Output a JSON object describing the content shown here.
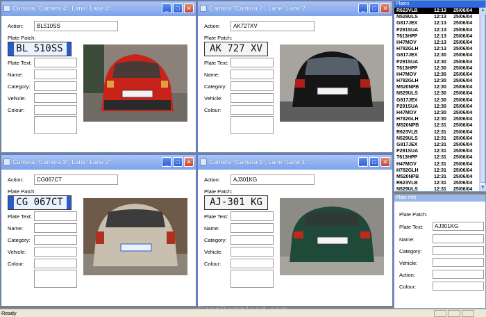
{
  "cameras": [
    {
      "title": "Camera \"Camera 4\", Lane \"Lane 4\"",
      "action": "BL510SS",
      "plate": "BL 510SS",
      "car": "red"
    },
    {
      "title": "Camera \"Camera 2\", Lane \"Lane 2\"",
      "action": "AK727XV",
      "plate": "AK 727 XV",
      "car": "black"
    },
    {
      "title": "Camera \"Camera 3\", Lane \"Lane 3\"",
      "action": "CG067CT",
      "plate": "CG 067CT",
      "car": "silver"
    },
    {
      "title": "Camera \"Camera 1\", Lane \"Lane 1\"",
      "action": "AJ301KG",
      "plate": "AJ-301 KG",
      "car": "green"
    }
  ],
  "labels": {
    "action": "Action:",
    "plate_patch": "Plate Patch:",
    "plate_text": "Plate Text:",
    "name": "Name:",
    "category": "Category:",
    "vehicle": "Vehicle:",
    "colour": "Colour:"
  },
  "plates_panel": {
    "title": "Plates",
    "rows": [
      [
        "R623VLB",
        "12:13",
        "25/06/04"
      ],
      [
        "N529ULS",
        "12:13",
        "25/06/04"
      ],
      [
        "G817JEX",
        "12:13",
        "25/06/04"
      ],
      [
        "P291SUA",
        "12:13",
        "25/06/04"
      ],
      [
        "T613HPP",
        "12:13",
        "25/06/04"
      ],
      [
        "H47MOV",
        "12:13",
        "25/06/04"
      ],
      [
        "H782GLH",
        "12:13",
        "25/06/04"
      ],
      [
        "G817JEX",
        "12:30",
        "25/06/04"
      ],
      [
        "P291SUA",
        "12:30",
        "25/06/04"
      ],
      [
        "T613HPP",
        "12:30",
        "25/06/04"
      ],
      [
        "H47MOV",
        "12:30",
        "25/06/04"
      ],
      [
        "H782GLH",
        "12:30",
        "25/06/04"
      ],
      [
        "M520NPB",
        "12:30",
        "25/06/04"
      ],
      [
        "N529ULS",
        "12:30",
        "25/06/04"
      ],
      [
        "G817JEX",
        "12:30",
        "25/06/04"
      ],
      [
        "P291SUA",
        "12:30",
        "25/06/04"
      ],
      [
        "H47MOV",
        "12:30",
        "25/06/04"
      ],
      [
        "H782GLH",
        "12:30",
        "25/06/04"
      ],
      [
        "M520NPB",
        "12:31",
        "25/06/04"
      ],
      [
        "R623VLB",
        "12:31",
        "25/06/04"
      ],
      [
        "N529ULS",
        "12:31",
        "25/06/04"
      ],
      [
        "G817JEX",
        "12:31",
        "25/06/04"
      ],
      [
        "P291SUA",
        "12:31",
        "25/06/04"
      ],
      [
        "T613HPP",
        "12:31",
        "25/06/04"
      ],
      [
        "H47MOV",
        "12:31",
        "25/06/04"
      ],
      [
        "H782GLH",
        "12:31",
        "25/06/04"
      ],
      [
        "M520NPB",
        "12:31",
        "25/06/04"
      ],
      [
        "R623VLB",
        "12:31",
        "25/06/04"
      ],
      [
        "N529ULS",
        "12:31",
        "25/06/04"
      ]
    ]
  },
  "info_panel": {
    "title": "Plate Info",
    "plate_patch_label": "Plate Patch:",
    "plate_text_label": "Plate Text:",
    "plate_text_value": "AJ301KG",
    "name_label": "Name:",
    "category_label": "Category:",
    "vehicle_label": "Vehicle:",
    "action_label": "Action:",
    "colour_label": "Colour:"
  },
  "status_text": "Ready",
  "watermark": "GearDownload.com",
  "colors": {
    "titlebar": "#7da2ea",
    "selected_row": "#000000",
    "panel_title": "#2d6ae0"
  }
}
